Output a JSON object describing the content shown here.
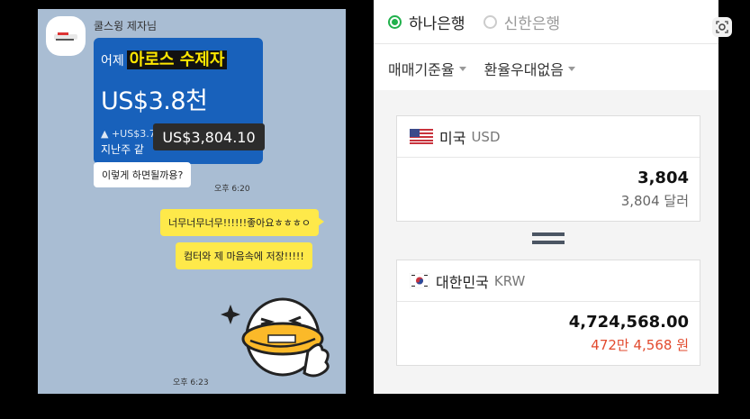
{
  "chat": {
    "sender_name": "쿨스윙 제자님",
    "image_message": {
      "line1_prefix": "어제",
      "line1_highlight": "아로스 수제자",
      "big_amount": "US$3.8천",
      "small_line1": "▲ +US$3.74천 (+ 599%)",
      "small_line2": "지난주 같",
      "tooltip": "US$3,804.10"
    },
    "received_message": "이렇게 하면될까용?",
    "received_time": "오후 6:20",
    "sent_messages": [
      "너무너무너무!!!!!!좋아요ㅎㅎㅎㅇ",
      "컴터와 제 마음속에 저장!!!!!"
    ],
    "sticker_time": "오후 6:23"
  },
  "converter": {
    "banks": [
      {
        "label": "하나은행",
        "selected": true
      },
      {
        "label": "신한은행",
        "selected": false
      }
    ],
    "rate_option": "매매기준율",
    "discount_option": "환율우대없음",
    "from": {
      "country": "미국",
      "code": "USD",
      "value": "3,804",
      "sub": "3,804 달러"
    },
    "to": {
      "country": "대한민국",
      "code": "KRW",
      "value": "4,724,568.00",
      "sub": "472만 4,568 원"
    }
  },
  "colors": {
    "chat_bg": "#a9bdd3",
    "bubble_yellow": "#fee94a",
    "radio_green": "#21b14c",
    "krw_sub_red": "#e24a2e"
  },
  "icons": [
    "lens-icon",
    "caret-down-icon",
    "us-flag-icon",
    "kr-flag-icon",
    "equals-icon"
  ]
}
